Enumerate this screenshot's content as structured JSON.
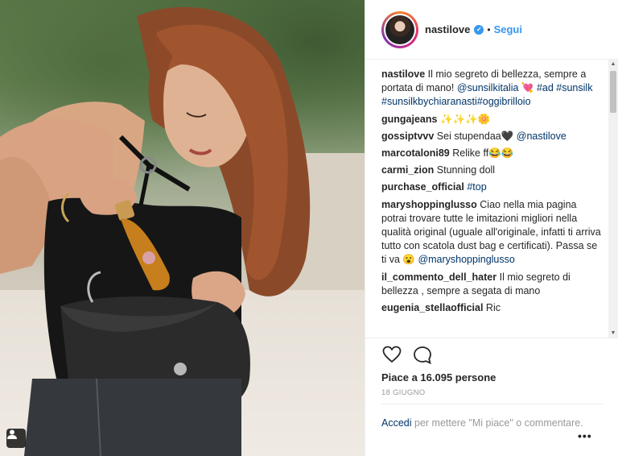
{
  "post": {
    "username": "nastilove",
    "follow_label": "Segui",
    "separator": "•",
    "likes_text": "Piace a 16.095 persone",
    "date": "18 GIUGNO",
    "login_link": "Accedi",
    "login_suffix": " per mettere \"Mi piace\" o commentare.",
    "more_label": "•••"
  },
  "comments": [
    {
      "user": "nastilove",
      "text": "Il mio segreto di bellezza, sempre a portata di mano! ",
      "tags": [
        "@sunsilkitalia"
      ],
      "emoji": " 💘 ",
      "tags2": [
        "#ad",
        "#sunsilk",
        "#sunsilkbychiaranasti#oggibrilloio"
      ]
    },
    {
      "user": "gungajeans",
      "text": "✨✨✨🌼"
    },
    {
      "user": "gossiptvvv",
      "text": "Sei stupendaa🖤 ",
      "tags": [
        "@nastilove"
      ]
    },
    {
      "user": "marcotaloni89",
      "text": "Relike ff😂😂"
    },
    {
      "user": "carmi_zion",
      "text": "Stunning doll"
    },
    {
      "user": "purchase_official",
      "text": "",
      "tags": [
        "#top"
      ]
    },
    {
      "user": "maryshoppinglusso",
      "text": "Ciao nella mia pagina potrai trovare tutte le imitazioni migliori nella qualità original (uguale all'originale, infatti ti arriva tutto con scatola dust bag e certificati). Passa se ti va 😮 ",
      "tags": [
        "@maryshoppinglusso"
      ]
    },
    {
      "user": "il_commento_dell_hater",
      "text": "Il mio segreto di bellezza , sempre a segata di mano"
    },
    {
      "user": "eugenia_stellaofficial",
      "text": "Ric"
    }
  ],
  "colors": {
    "link": "#3897f0",
    "hashtag": "#003569",
    "muted": "#999999"
  },
  "icons": [
    "heart-icon",
    "comment-icon",
    "more-icon",
    "user-tag-icon",
    "verified-icon"
  ]
}
